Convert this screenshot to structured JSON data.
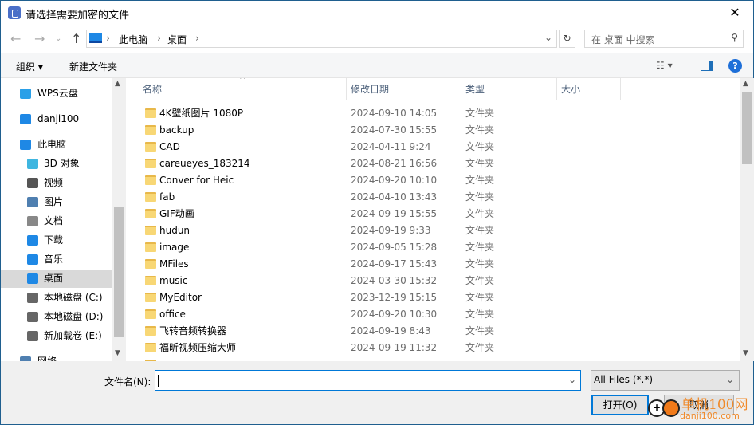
{
  "window": {
    "title": "请选择需要加密的文件",
    "close": "✕"
  },
  "address": {
    "crumbs": [
      "此电脑",
      "桌面"
    ],
    "search_placeholder": "在 桌面 中搜索"
  },
  "toolbar": {
    "organize": "组织 ▾",
    "new_folder": "新建文件夹"
  },
  "nav": [
    {
      "label": "WPS云盘",
      "top": true,
      "color": "#2aa0e8"
    },
    {
      "label": "danji100",
      "top": true,
      "color": "#1e88e5"
    },
    {
      "label": "此电脑",
      "top": true,
      "color": "#1e88e5"
    },
    {
      "label": "3D 对象",
      "color": "#3fb6e0"
    },
    {
      "label": "视频",
      "color": "#555"
    },
    {
      "label": "图片",
      "color": "#4f7fb0"
    },
    {
      "label": "文档",
      "color": "#888"
    },
    {
      "label": "下载",
      "color": "#1e88e5"
    },
    {
      "label": "音乐",
      "color": "#1e88e5"
    },
    {
      "label": "桌面",
      "selected": true,
      "color": "#1e88e5"
    },
    {
      "label": "本地磁盘 (C:)",
      "color": "#666"
    },
    {
      "label": "本地磁盘 (D:)",
      "color": "#666"
    },
    {
      "label": "新加载卷 (E:)",
      "color": "#666"
    },
    {
      "label": "网络",
      "top": true,
      "color": "#4f7fb0"
    }
  ],
  "columns": [
    "名称",
    "修改日期",
    "类型",
    "大小"
  ],
  "files": [
    {
      "name": "4K壁纸图片 1080P",
      "date": "2024-09-10 14:05",
      "type": "文件夹"
    },
    {
      "name": "backup",
      "date": "2024-07-30 15:55",
      "type": "文件夹"
    },
    {
      "name": "CAD",
      "date": "2024-04-11 9:24",
      "type": "文件夹"
    },
    {
      "name": "careueyes_183214",
      "date": "2024-08-21 16:56",
      "type": "文件夹"
    },
    {
      "name": "Conver for Heic",
      "date": "2024-09-20 10:10",
      "type": "文件夹"
    },
    {
      "name": "fab",
      "date": "2024-04-10 13:43",
      "type": "文件夹"
    },
    {
      "name": "GIF动画",
      "date": "2024-09-19 15:55",
      "type": "文件夹"
    },
    {
      "name": "hudun",
      "date": "2024-09-19 9:33",
      "type": "文件夹"
    },
    {
      "name": "image",
      "date": "2024-09-05 15:28",
      "type": "文件夹"
    },
    {
      "name": "MFiles",
      "date": "2024-09-17 15:43",
      "type": "文件夹"
    },
    {
      "name": "music",
      "date": "2024-03-30 15:32",
      "type": "文件夹"
    },
    {
      "name": "MyEditor",
      "date": "2023-12-19 15:15",
      "type": "文件夹"
    },
    {
      "name": "office",
      "date": "2024-09-20 10:30",
      "type": "文件夹"
    },
    {
      "name": "飞转音频转换器",
      "date": "2024-09-19 8:43",
      "type": "文件夹"
    },
    {
      "name": "福昕视频压缩大师",
      "date": "2024-09-19 11:32",
      "type": "文件夹"
    },
    {
      "name": "",
      "date": "",
      "type": ""
    }
  ],
  "bottom": {
    "filename_label": "文件名(N):",
    "filename_value": "",
    "filter": "All Files (*.*)",
    "open": "打开(O)",
    "cancel": "取消"
  },
  "watermark": {
    "line1": "单机100网",
    "line2": "danji100.com"
  }
}
